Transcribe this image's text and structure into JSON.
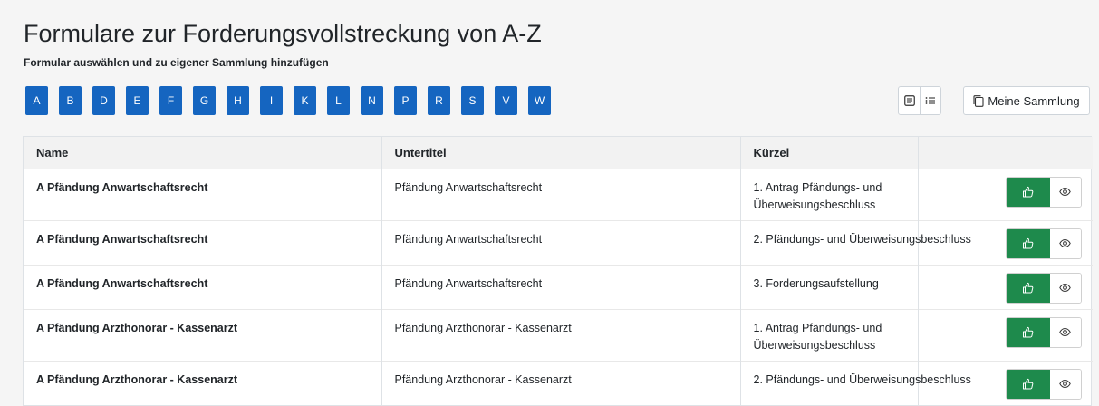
{
  "header": {
    "title": "Formulare zur Forderungsvollstreckung von A-Z",
    "subtitle": "Formular auswählen und zu eigener Sammlung hinzufügen"
  },
  "alphabet": [
    "A",
    "B",
    "D",
    "E",
    "F",
    "G",
    "H",
    "I",
    "K",
    "L",
    "N",
    "P",
    "R",
    "S",
    "V",
    "W"
  ],
  "toolbar": {
    "card_view_icon": "card-view-icon",
    "list_view_icon": "list-view-icon",
    "collection_label": "Meine Sammlung",
    "collection_icon": "copy-icon"
  },
  "table": {
    "columns": [
      "Name",
      "Untertitel",
      "Kürzel",
      ""
    ],
    "rows": [
      {
        "name": "A Pfändung Anwartschaftsrecht",
        "subtitle": "Pfändung Anwartschaftsrecht",
        "kuerzel_line1": "1. Antrag Pfändungs- und",
        "kuerzel_line2": "Überweisungsbeschluss"
      },
      {
        "name": "A Pfändung Anwartschaftsrecht",
        "subtitle": "Pfändung Anwartschaftsrecht",
        "kuerzel_line1": "2. Pfändungs- und Überweisungsbeschluss",
        "kuerzel_line2": ""
      },
      {
        "name": "A Pfändung Anwartschaftsrecht",
        "subtitle": "Pfändung Anwartschaftsrecht",
        "kuerzel_line1": "3. Forderungsaufstellung",
        "kuerzel_line2": ""
      },
      {
        "name": "A Pfändung Arzthonorar - Kassenarzt",
        "subtitle": "Pfändung Arzthonorar - Kassenarzt",
        "kuerzel_line1": "1. Antrag Pfändungs- und",
        "kuerzel_line2": "Überweisungsbeschluss"
      },
      {
        "name": "A Pfändung Arzthonorar - Kassenarzt",
        "subtitle": "Pfändung Arzthonorar - Kassenarzt",
        "kuerzel_line1": "2. Pfändungs- und Überweisungsbeschluss",
        "kuerzel_line2": ""
      }
    ],
    "row_actions": {
      "like_icon": "thumbs-up-icon",
      "view_icon": "eye-icon"
    }
  },
  "colors": {
    "letter_button": "#1565c0",
    "like_button": "#1e8a4c",
    "background": "#f5f5f5"
  }
}
